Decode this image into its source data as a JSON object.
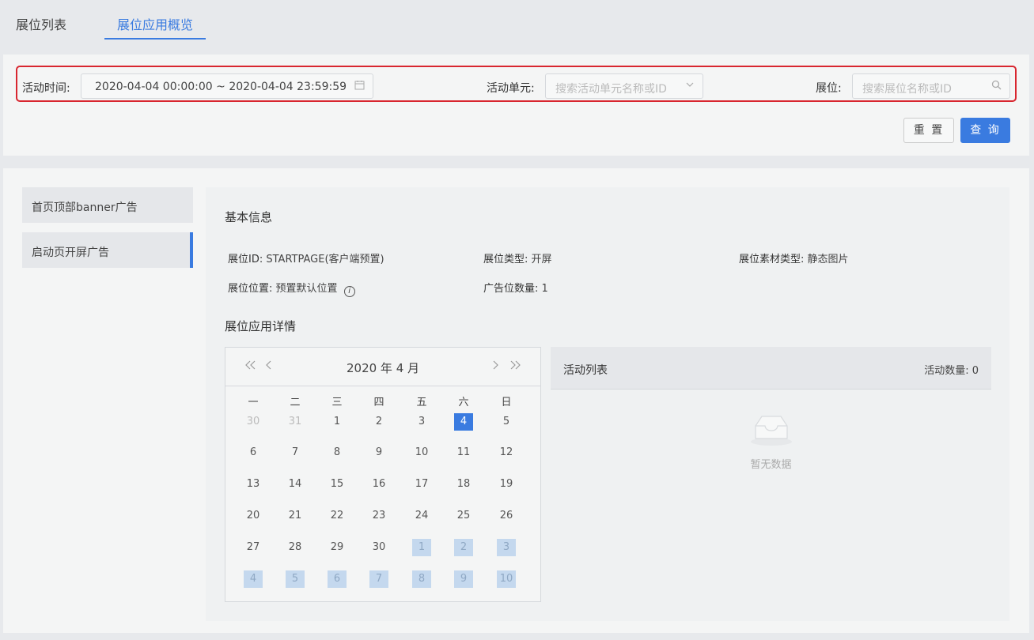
{
  "tabs": [
    {
      "label": "展位列表"
    },
    {
      "label": "展位应用概览"
    }
  ],
  "filters": {
    "time_label": "活动时间:",
    "time_value": "2020-04-04 00:00:00 ~ 2020-04-04 23:59:59",
    "unit_label": "活动单元:",
    "unit_placeholder": "搜索活动单元名称或ID",
    "position_label": "展位:",
    "position_placeholder": "搜索展位名称或ID",
    "reset_label": "重 置",
    "query_label": "查 询"
  },
  "sidebar": {
    "items": [
      {
        "label": "首页顶部banner广告"
      },
      {
        "label": "启动页开屏广告",
        "active": true
      }
    ]
  },
  "basic": {
    "title": "基本信息",
    "id_key": "展位ID:",
    "id_value": "STARTPAGE(客户端预置)",
    "type_key": "展位类型:",
    "type_value": "开屏",
    "material_key": "展位素材类型:",
    "material_value": "静态图片",
    "location_key": "展位位置:",
    "location_value": "预置默认位置",
    "count_key": "广告位数量:",
    "count_value": "1"
  },
  "detail": {
    "title": "展位应用详情"
  },
  "calendar": {
    "title": "2020 年 4 月",
    "weekdays": [
      "一",
      "二",
      "三",
      "四",
      "五",
      "六",
      "日"
    ],
    "rows": [
      [
        "30",
        "31",
        "1",
        "2",
        "3",
        "4",
        "5"
      ],
      [
        "6",
        "7",
        "8",
        "9",
        "10",
        "11",
        "12"
      ],
      [
        "13",
        "14",
        "15",
        "16",
        "17",
        "18",
        "19"
      ],
      [
        "20",
        "21",
        "22",
        "23",
        "24",
        "25",
        "26"
      ],
      [
        "27",
        "28",
        "29",
        "30",
        "1",
        "2",
        "3"
      ],
      [
        "4",
        "5",
        "6",
        "7",
        "8",
        "9",
        "10"
      ]
    ],
    "selected_day": "4"
  },
  "activity": {
    "title": "活动列表",
    "count_label": "活动数量: 0",
    "empty_text": "暂无数据"
  }
}
